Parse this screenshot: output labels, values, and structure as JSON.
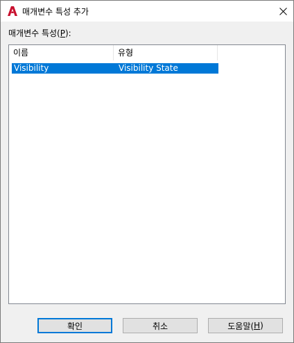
{
  "window": {
    "title": "매개변수 특성 추가",
    "app_icon": "autocad-a-icon",
    "close_icon": "close-icon"
  },
  "list": {
    "caption_prefix": "매개변수 특성(",
    "caption_mnemonic": "P",
    "caption_suffix": "):",
    "columns": [
      "이름",
      "유형"
    ],
    "rows": [
      {
        "name": "Visibility",
        "type": "Visibility State",
        "selected": true
      }
    ]
  },
  "buttons": {
    "ok": "확인",
    "cancel": "취소",
    "help_prefix": "도움말(",
    "help_mnemonic": "H",
    "help_suffix": ")"
  },
  "colors": {
    "selection": "#0078d7",
    "title_bar": "#ffffff",
    "dialog_bg": "#f0f0f0",
    "app_icon_red": "#c8102e"
  }
}
